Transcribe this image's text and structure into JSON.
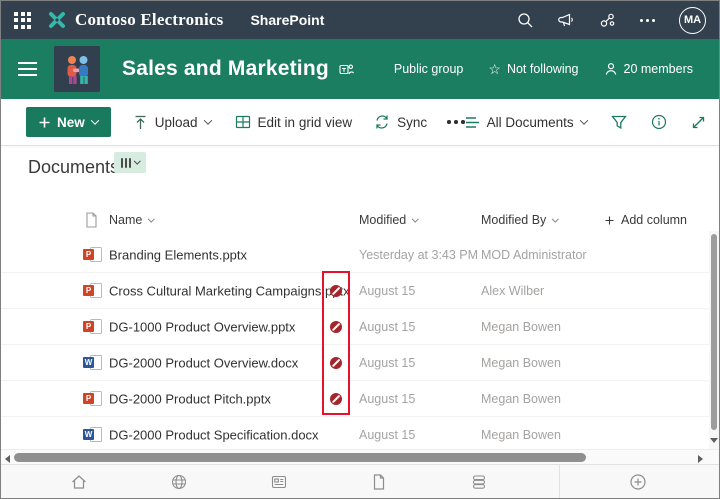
{
  "suite_bar": {
    "brand": "Contoso Electronics",
    "app": "SharePoint",
    "avatar_initials": "MA"
  },
  "site_header": {
    "title": "Sales and Marketing",
    "privacy": "Public group",
    "following": "Not following",
    "members": "20 members"
  },
  "command_bar": {
    "new": "New",
    "upload": "Upload",
    "edit_grid": "Edit in grid view",
    "sync": "Sync",
    "view": "All Documents"
  },
  "list": {
    "title": "Documents",
    "columns": {
      "name": "Name",
      "modified": "Modified",
      "modified_by": "Modified By"
    },
    "add_column": "Add column",
    "rows": [
      {
        "name": "Branding Elements.pptx",
        "type": "pptx",
        "modified": "Yesterday at 3:43 PM",
        "modified_by": "MOD Administrator",
        "sharing_blocked": false
      },
      {
        "name": "Cross Cultural Marketing Campaigns.pptx",
        "type": "pptx",
        "modified": "August 15",
        "modified_by": "Alex Wilber",
        "sharing_blocked": true
      },
      {
        "name": "DG-1000 Product Overview.pptx",
        "type": "pptx",
        "modified": "August 15",
        "modified_by": "Megan Bowen",
        "sharing_blocked": true
      },
      {
        "name": "DG-2000 Product Overview.docx",
        "type": "docx",
        "modified": "August 15",
        "modified_by": "Megan Bowen",
        "sharing_blocked": true
      },
      {
        "name": "DG-2000 Product Pitch.pptx",
        "type": "pptx",
        "modified": "August 15",
        "modified_by": "Megan Bowen",
        "sharing_blocked": true
      },
      {
        "name": "DG-2000 Product Specification.docx",
        "type": "docx",
        "modified": "August 15",
        "modified_by": "Megan Bowen",
        "sharing_blocked": false
      }
    ]
  },
  "icons": {
    "waffle": "app-launcher-grid",
    "contoso_logo": "teal-x-mark",
    "search": "magnifier",
    "megaphone": "announcement-horn",
    "org": "org-chart",
    "more": "ellipsis",
    "hamburger": "menu-lines",
    "site_logo": "two-people-handshake",
    "teams": "teams-people",
    "star": "follow-star",
    "person": "member-person",
    "upload": "arrow-up-from-bar",
    "edit_grid": "table-grid",
    "sync": "circular-arrows",
    "view_selector": "list-lines",
    "filter": "funnel",
    "info": "info-circle",
    "expand": "diagonal-resize-arrows",
    "sharing_blocked": "red-circle-slash",
    "footer": [
      "home",
      "globe",
      "news-card",
      "page",
      "library-stack",
      "plus-circle"
    ]
  },
  "colors": {
    "suite_bar_bg": "#33404e",
    "theme_green": "#1b7e61",
    "button_green": "#197a5e",
    "command_icon_teal": "#1d7a5f",
    "logo_teal": "#35b7aa",
    "ppt_orange": "#d04423",
    "word_blue": "#2b579a",
    "blocked_red": "#a4262c",
    "highlight_red": "#e8112d",
    "muted_text": "#a5a3a1"
  }
}
